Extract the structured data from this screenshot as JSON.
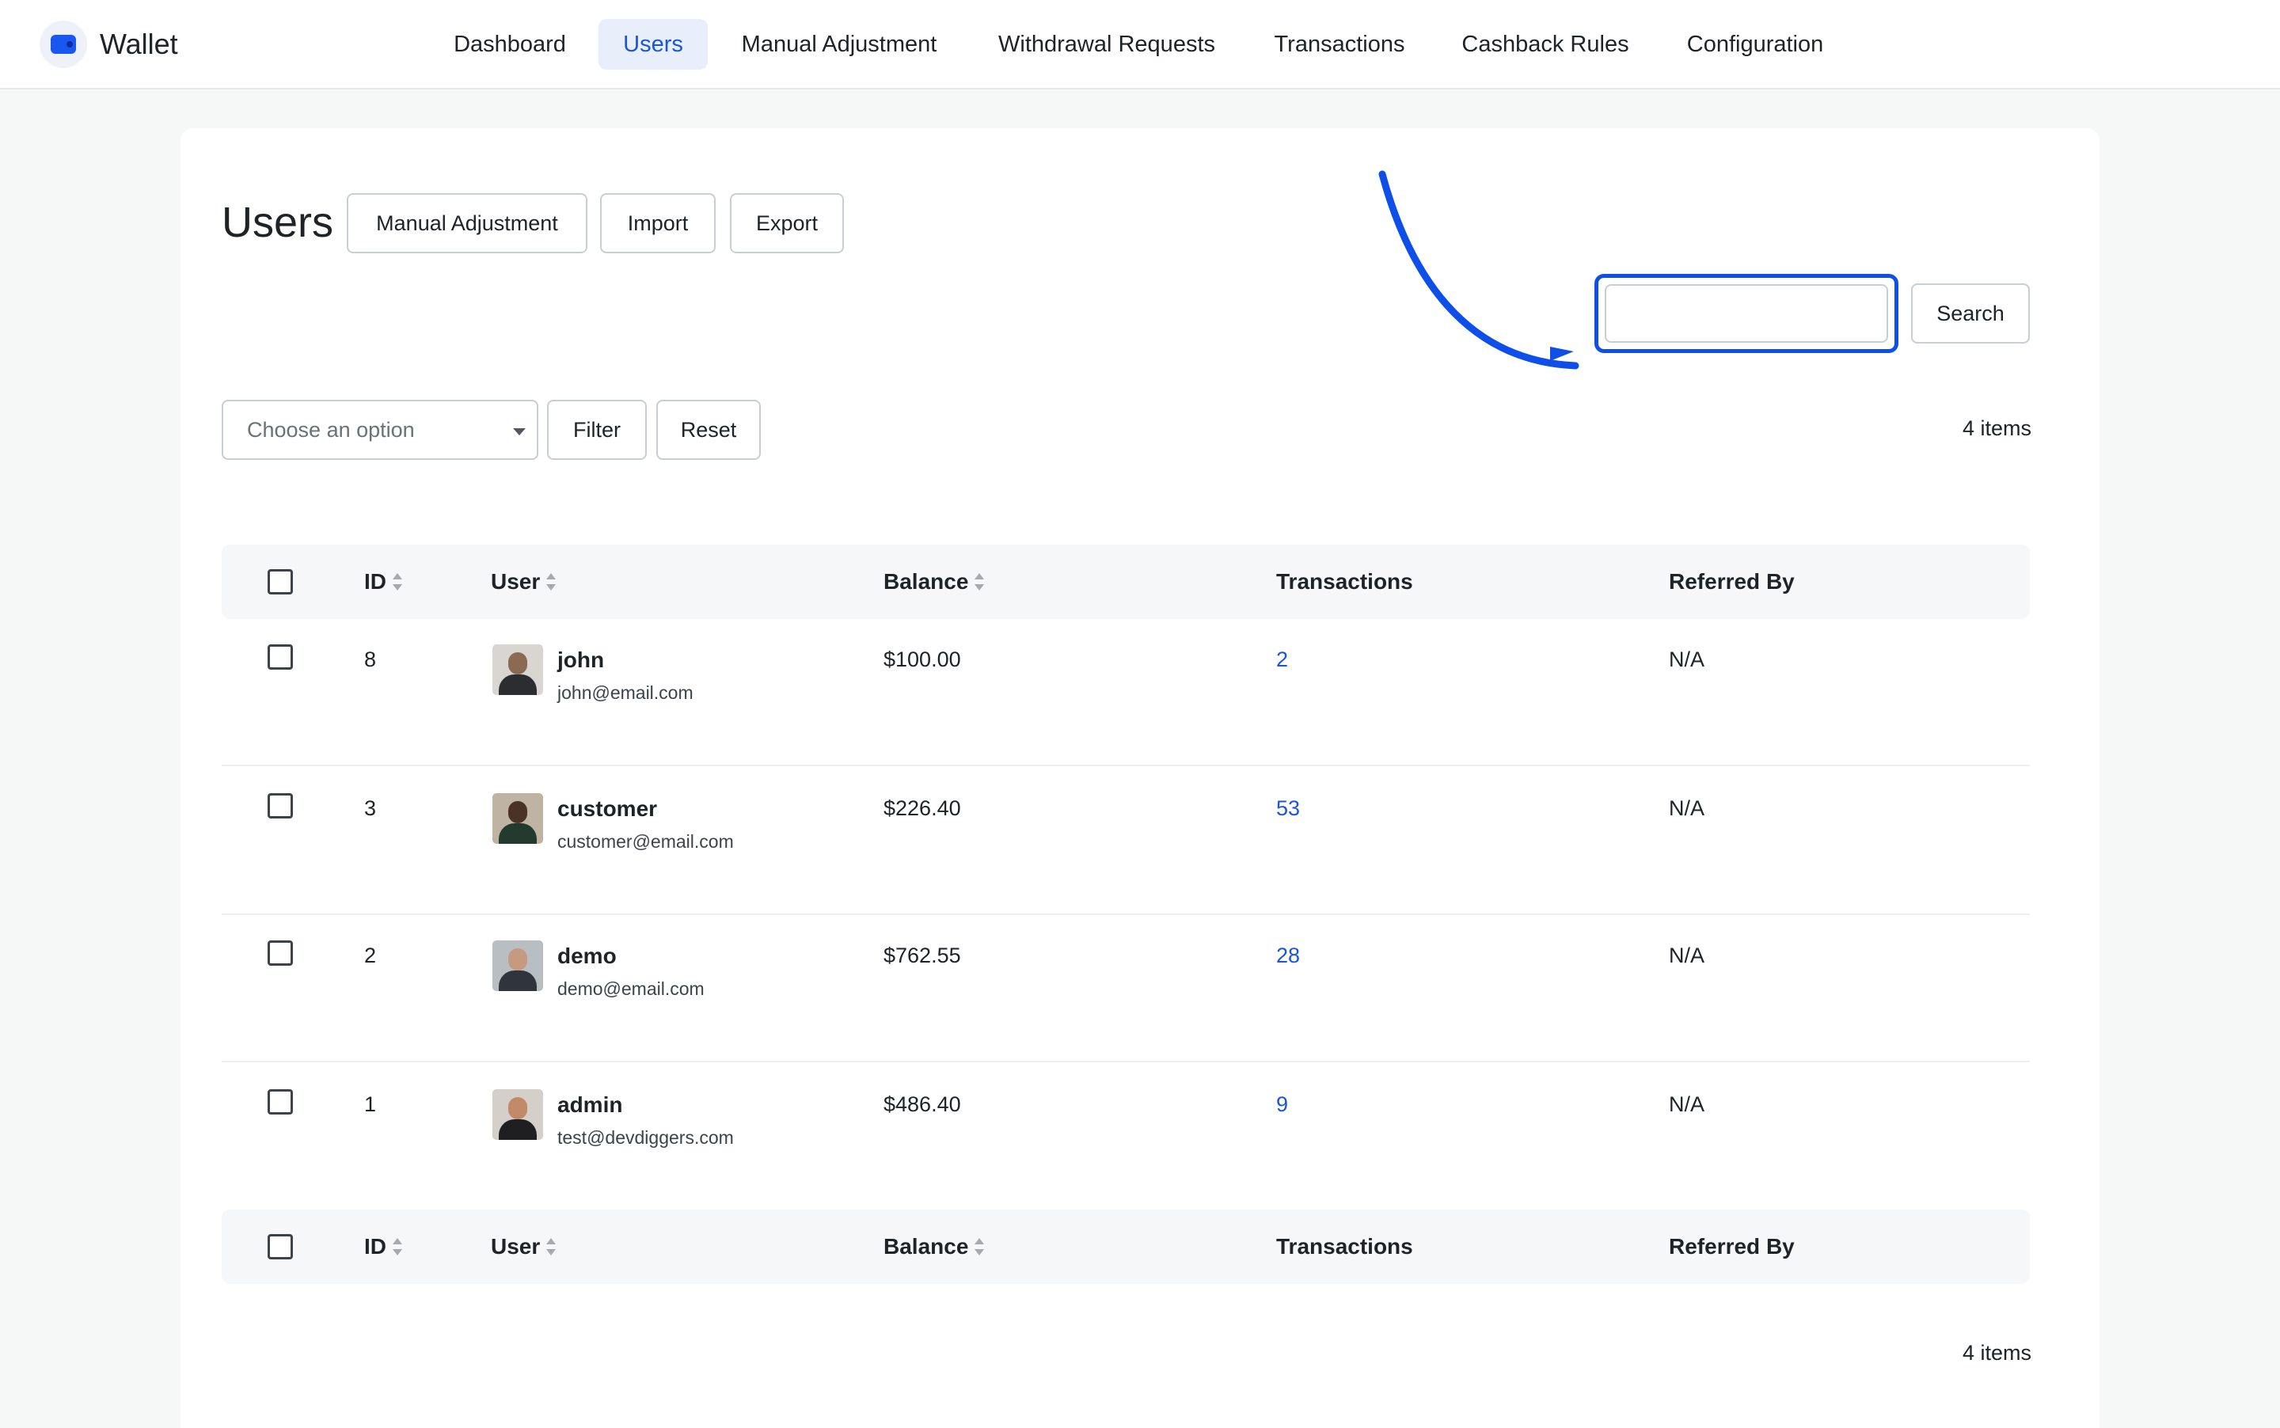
{
  "app": {
    "name": "Wallet"
  },
  "nav": {
    "items": [
      {
        "label": "Dashboard"
      },
      {
        "label": "Users"
      },
      {
        "label": "Manual Adjustment"
      },
      {
        "label": "Withdrawal Requests"
      },
      {
        "label": "Transactions"
      },
      {
        "label": "Cashback Rules"
      },
      {
        "label": "Configuration"
      }
    ],
    "active": "Users"
  },
  "page": {
    "title": "Users",
    "actions": {
      "manual_adjustment": "Manual Adjustment",
      "import": "Import",
      "export": "Export"
    }
  },
  "search": {
    "value": "",
    "button": "Search"
  },
  "filter": {
    "select_placeholder": "Choose an option",
    "filter_button": "Filter",
    "reset_button": "Reset",
    "count_top": "4 items",
    "count_bottom": "4 items"
  },
  "table": {
    "columns": {
      "id": "ID",
      "user": "User",
      "balance": "Balance",
      "transactions": "Transactions",
      "referred_by": "Referred By"
    },
    "rows": [
      {
        "id": "8",
        "name": "john",
        "email": "john@email.com",
        "balance": "$100.00",
        "transactions": "2",
        "referred_by": "N/A"
      },
      {
        "id": "3",
        "name": "customer",
        "email": "customer@email.com",
        "balance": "$226.40",
        "transactions": "53",
        "referred_by": "N/A"
      },
      {
        "id": "2",
        "name": "demo",
        "email": "demo@email.com",
        "balance": "$762.55",
        "transactions": "28",
        "referred_by": "N/A"
      },
      {
        "id": "1",
        "name": "admin",
        "email": "test@devdiggers.com",
        "balance": "$486.40",
        "transactions": "9",
        "referred_by": "N/A"
      }
    ]
  },
  "colors": {
    "accent": "#1a56d6",
    "highlight": "#0d4fe8",
    "brand": "#1a56f0"
  }
}
